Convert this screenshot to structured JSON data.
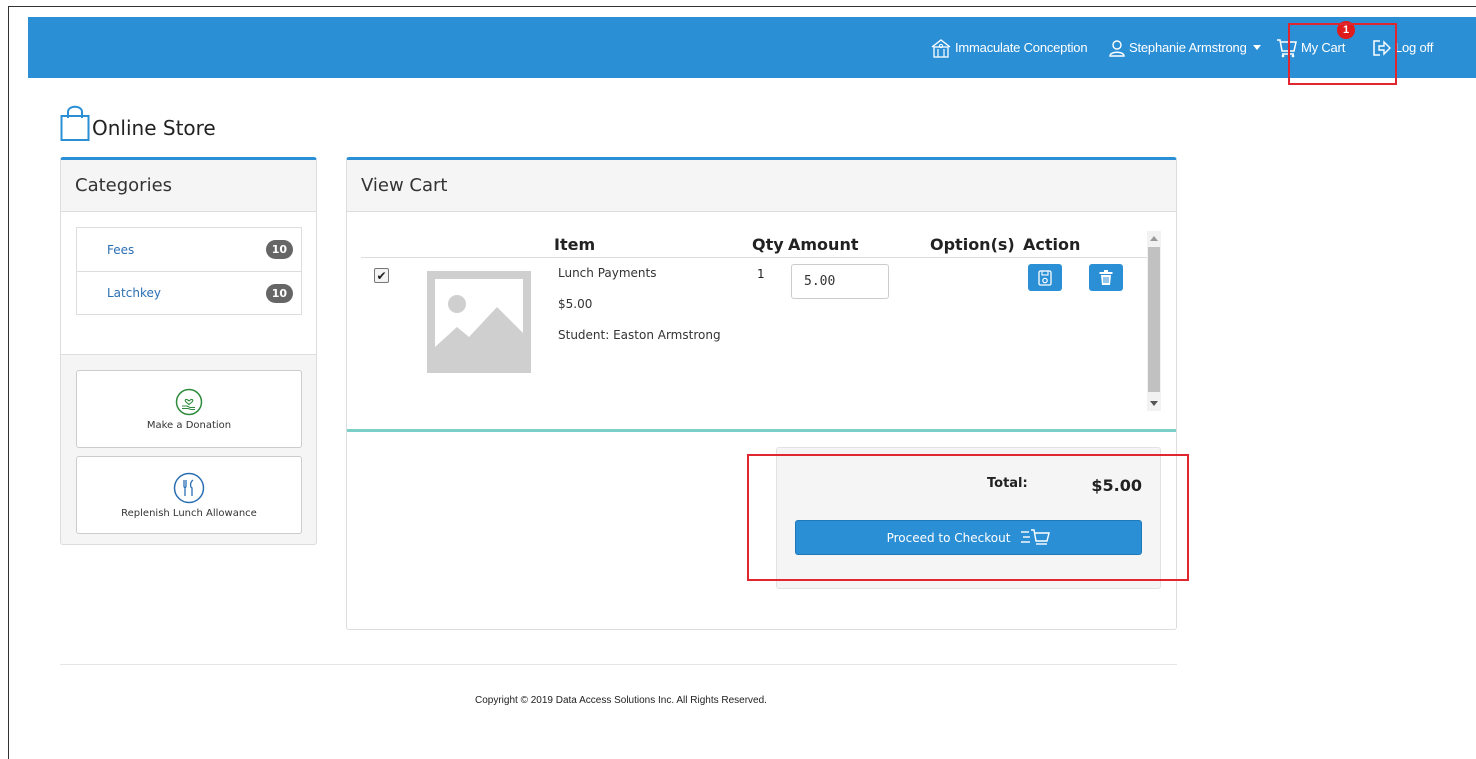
{
  "nav": {
    "school": "Immaculate Conception",
    "user": "Stephanie Armstrong",
    "cart_label": "My Cart",
    "cart_count": "1",
    "logoff": "Log off"
  },
  "page": {
    "title": "Online Store"
  },
  "categories": {
    "heading": "Categories",
    "items": [
      {
        "label": "Fees",
        "count": "10"
      },
      {
        "label": "Latchkey",
        "count": "10"
      }
    ],
    "tiles": [
      {
        "label": "Make a Donation",
        "icon": "donation-hand-heart-icon"
      },
      {
        "label": "Replenish Lunch Allowance",
        "icon": "fork-knife-icon"
      }
    ]
  },
  "cart": {
    "heading": "View Cart",
    "columns": {
      "item": "Item",
      "qty": "Qty",
      "amount": "Amount",
      "options": "Option(s)",
      "action": "Action"
    },
    "row": {
      "selected": true,
      "name": "Lunch Payments",
      "price": "$5.00",
      "student": "Student: Easton Armstrong",
      "qty": "1",
      "amount": "5.00"
    },
    "total_label": "Total:",
    "total_value": "$5.00",
    "checkout_label": "Proceed to Checkout"
  },
  "footer": {
    "copyright": "Copyright © 2019 Data Access Solutions Inc. All Rights Reserved."
  },
  "colors": {
    "brand": "#2b8fd6",
    "highlight": "#e0262e",
    "badge": "#e01b1b",
    "divider": "#7ccfc6"
  }
}
